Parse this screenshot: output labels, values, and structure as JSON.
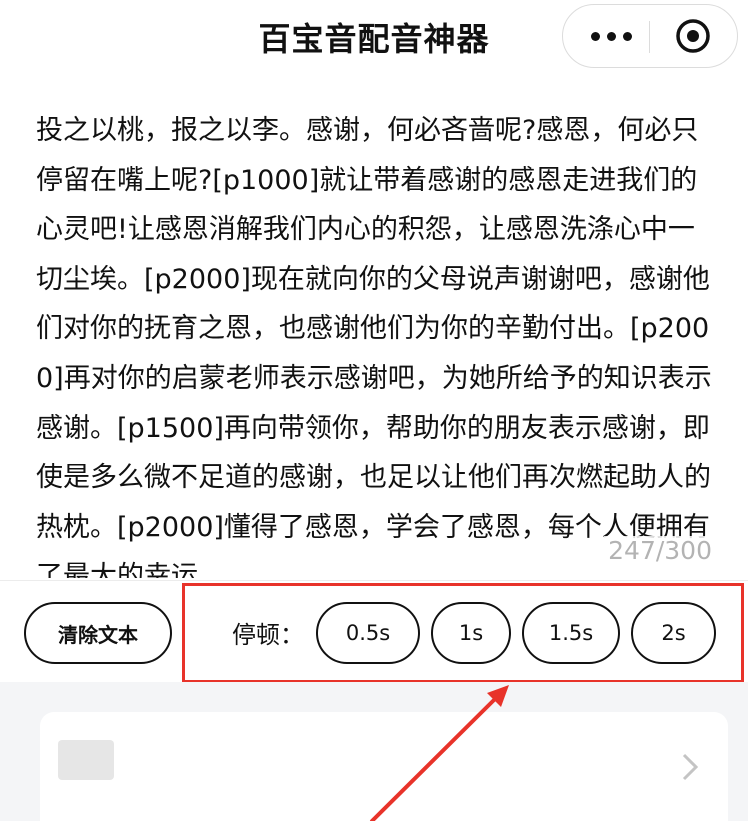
{
  "nav": {
    "title": "百宝音配音神器",
    "more_icon": "more-dots-icon",
    "close_icon": "target-circle-icon"
  },
  "editor": {
    "text": "投之以桃，报之以李。感谢，何必吝啬呢?感恩，何必只停留在嘴上呢?[p1000]就让带着感谢的感恩走进我们的心灵吧!让感恩消解我们内心的积怨，让感恩洗涤心中一切尘埃。[p2000]现在就向你的父母说声谢谢吧，感谢他们对你的抚育之恩，也感谢他们为你的辛勤付出。[p2000]再对你的启蒙老师表示感谢吧，为她所给予的知识表示感谢。[p1500]再向带领你，帮助你的朋友表示感谢，即使是多么微不足道的感谢，也足以让他们再次燃起助人的热枕。[p2000]懂得了感恩，学会了感恩，每个人便拥有了最大的幸运。",
    "counter": "247/300"
  },
  "toolbar": {
    "clear_label": "清除文本",
    "pause_label": "停顿：",
    "pause_options": [
      "0.5s",
      "1s",
      "1.5s",
      "2s"
    ]
  },
  "card": {
    "chevron_icon": "chevron-right-icon"
  },
  "colors": {
    "annotation_red": "#e8332a",
    "counter_gray": "#b3b3b3",
    "background_gray": "#f4f5f7"
  }
}
